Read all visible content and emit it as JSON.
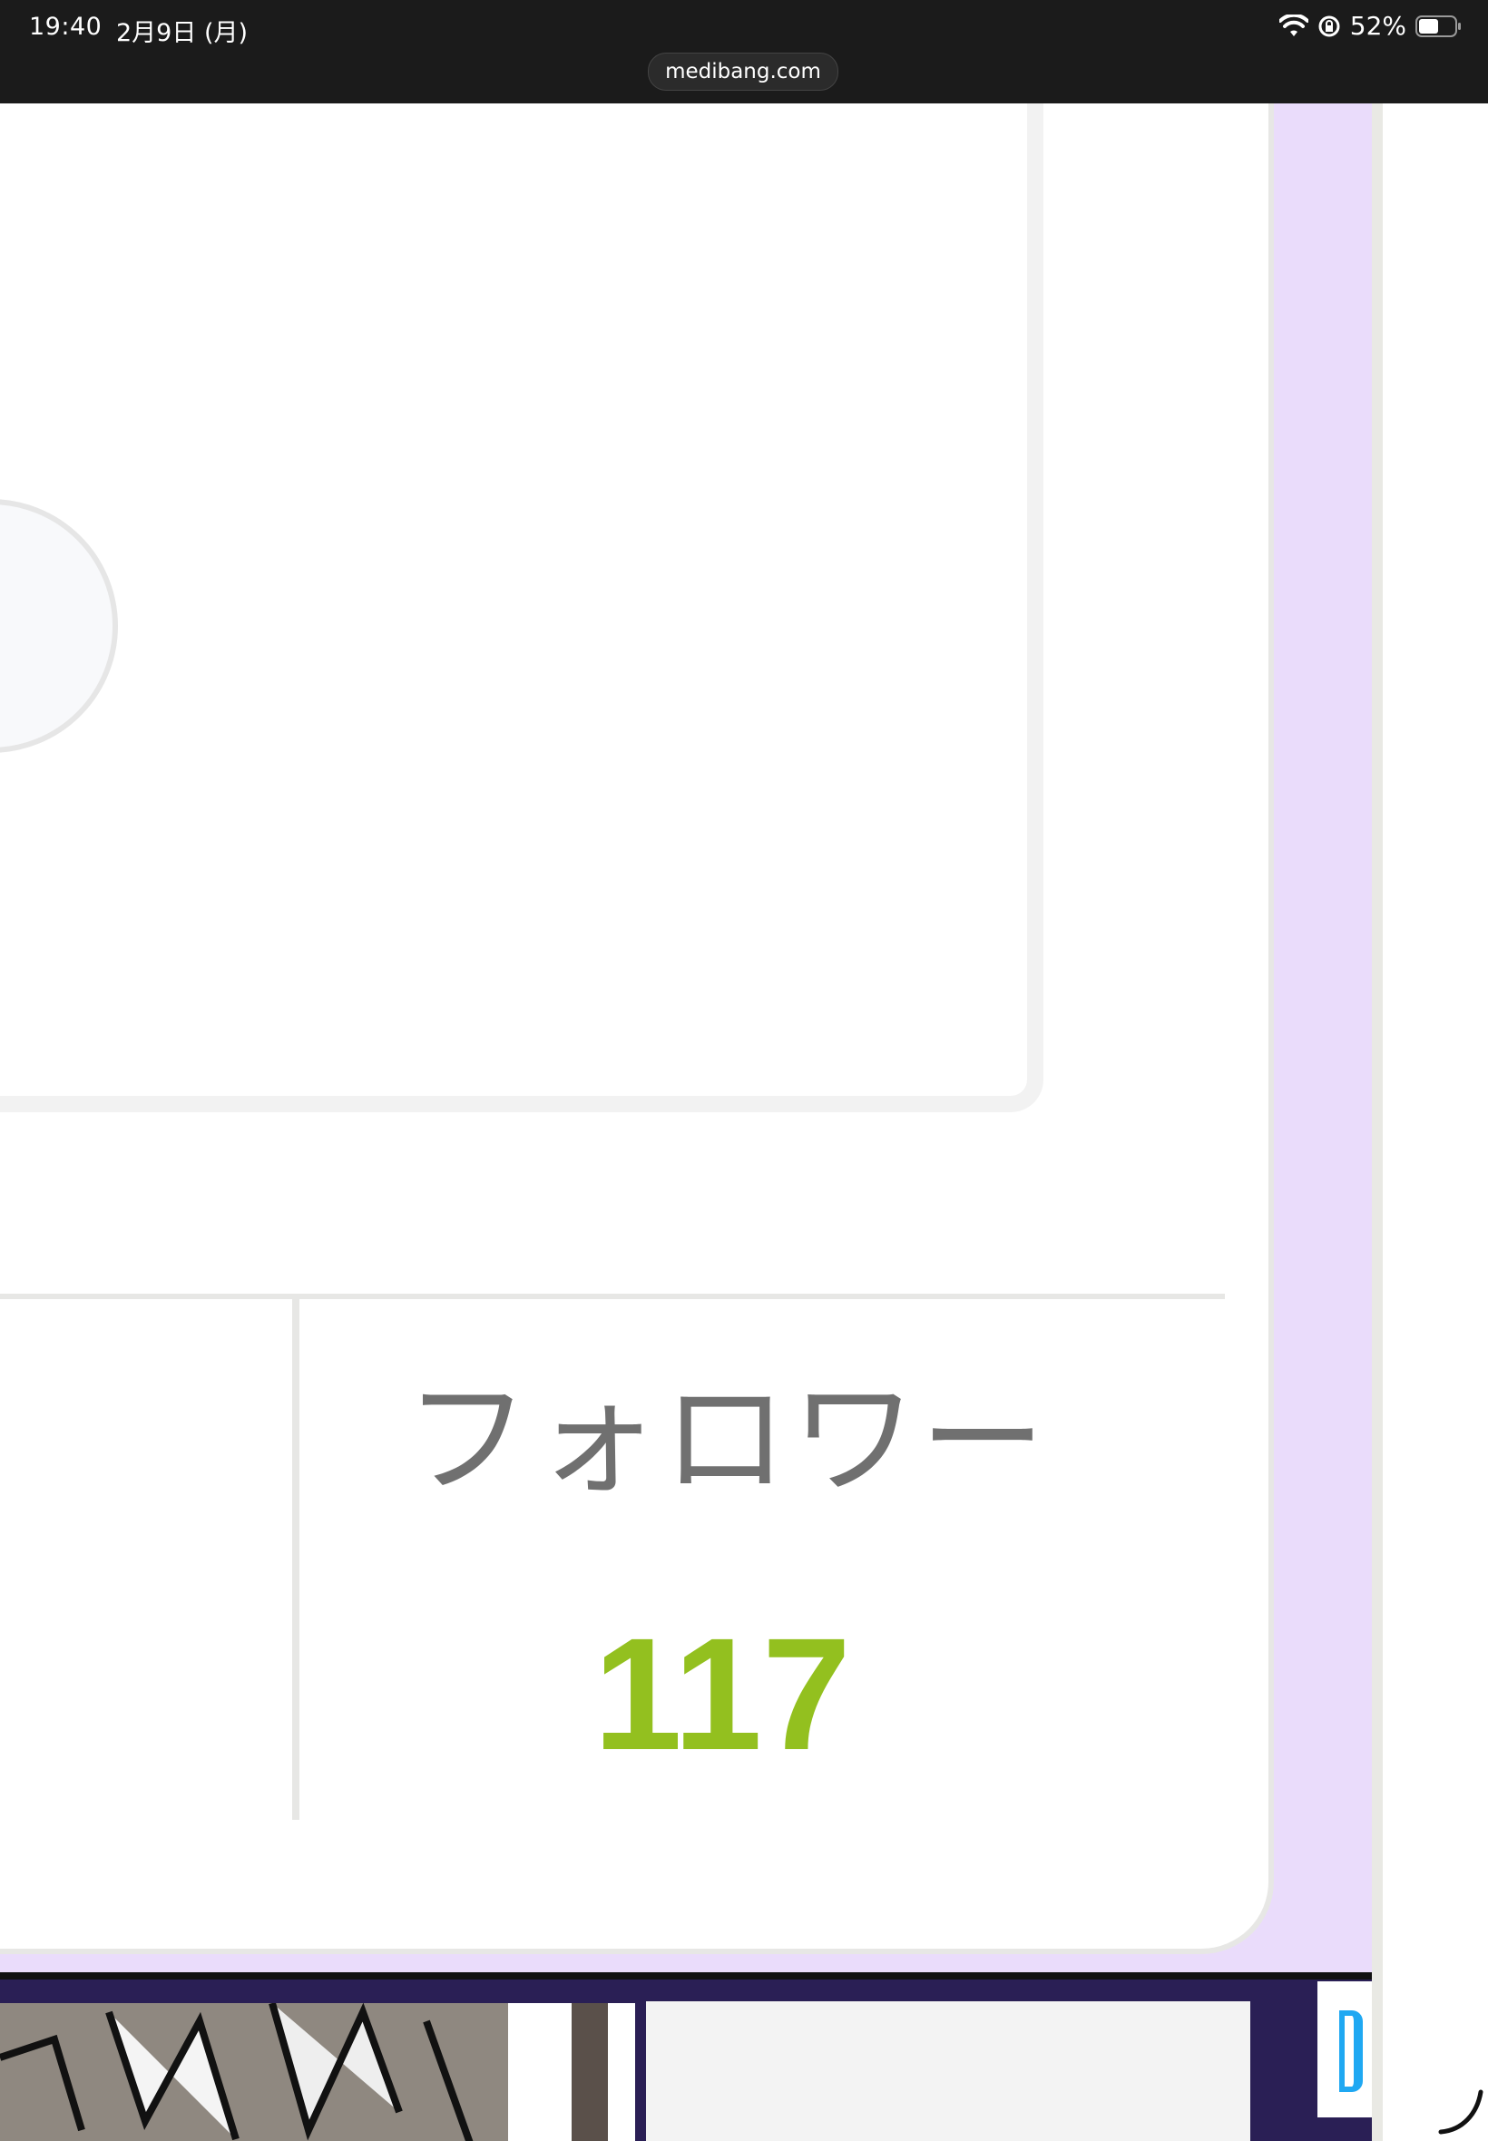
{
  "status_bar": {
    "time": "19:40",
    "date": "2月9日 (月)",
    "battery": "52%"
  },
  "browser": {
    "url": "medibang.com"
  },
  "profile_stats": {
    "follower_label": "フォロワー",
    "follower_count": "117"
  },
  "colors": {
    "panel_background": "#eadcfb",
    "count_green": "#93c01f",
    "label_gray": "#707070"
  },
  "icons": [
    "wifi-icon",
    "lock-rotation-icon",
    "battery-icon",
    "chevron-icon",
    "loading-arc-icon"
  ]
}
